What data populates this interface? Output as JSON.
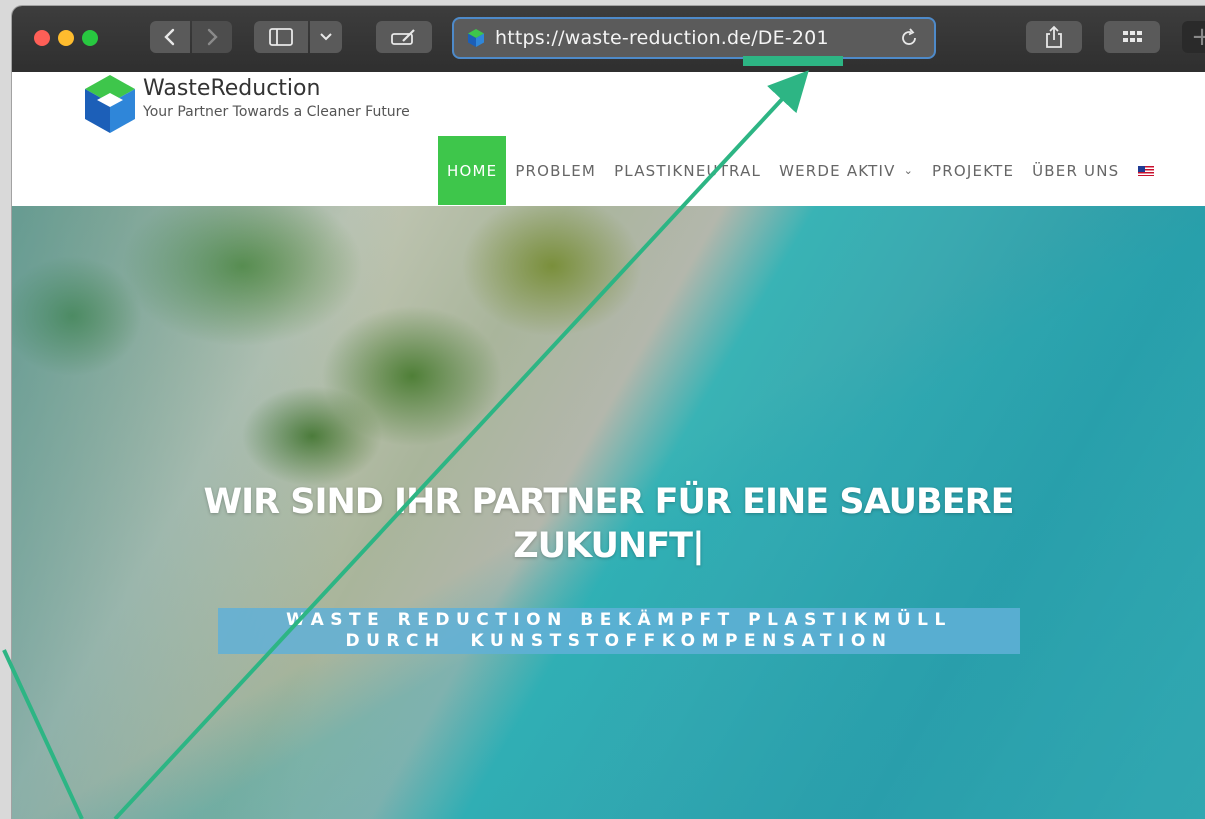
{
  "browser": {
    "url": "https://waste-reduction.de/DE-201",
    "favicon": "wastereduction-favicon",
    "buttons": {
      "back": "chevron-left-icon",
      "forward": "chevron-right-icon",
      "sidebar": "sidebar-icon",
      "sidebar_menu": "chevron-down-icon",
      "compose": "compose-icon",
      "reload": "reload-icon",
      "share": "share-icon",
      "tab_overview": "grid-icon",
      "new_tab": "+"
    }
  },
  "site": {
    "brand": {
      "name": "WasteReduction",
      "tagline": "Your Partner Towards a Cleaner Future"
    },
    "nav": [
      {
        "label": "HOME",
        "active": true
      },
      {
        "label": "PROBLEM"
      },
      {
        "label": "PLASTIKNEUTRAL"
      },
      {
        "label": "WERDE AKTIV",
        "has_dropdown": true
      },
      {
        "label": "PROJEKTE"
      },
      {
        "label": "ÜBER UNS"
      }
    ],
    "language_flag": "us-flag-icon",
    "hero": {
      "title_line1": "WIR SIND IHR PARTNER FÜR EINE SAUBERE",
      "title_line2": "ZUKUNFT|",
      "subtitle_line1": "WASTE REDUCTION BEKÄMPFT PLASTIKMÜLL",
      "subtitle_line2": "DURCH  KUNSTSTOFFKOMPENSATION"
    }
  },
  "colors": {
    "nav_active": "#3ec64b",
    "annotation": "#2db584",
    "subtitle_band": "#60b0d7",
    "address_focus": "#4e8ac9"
  }
}
